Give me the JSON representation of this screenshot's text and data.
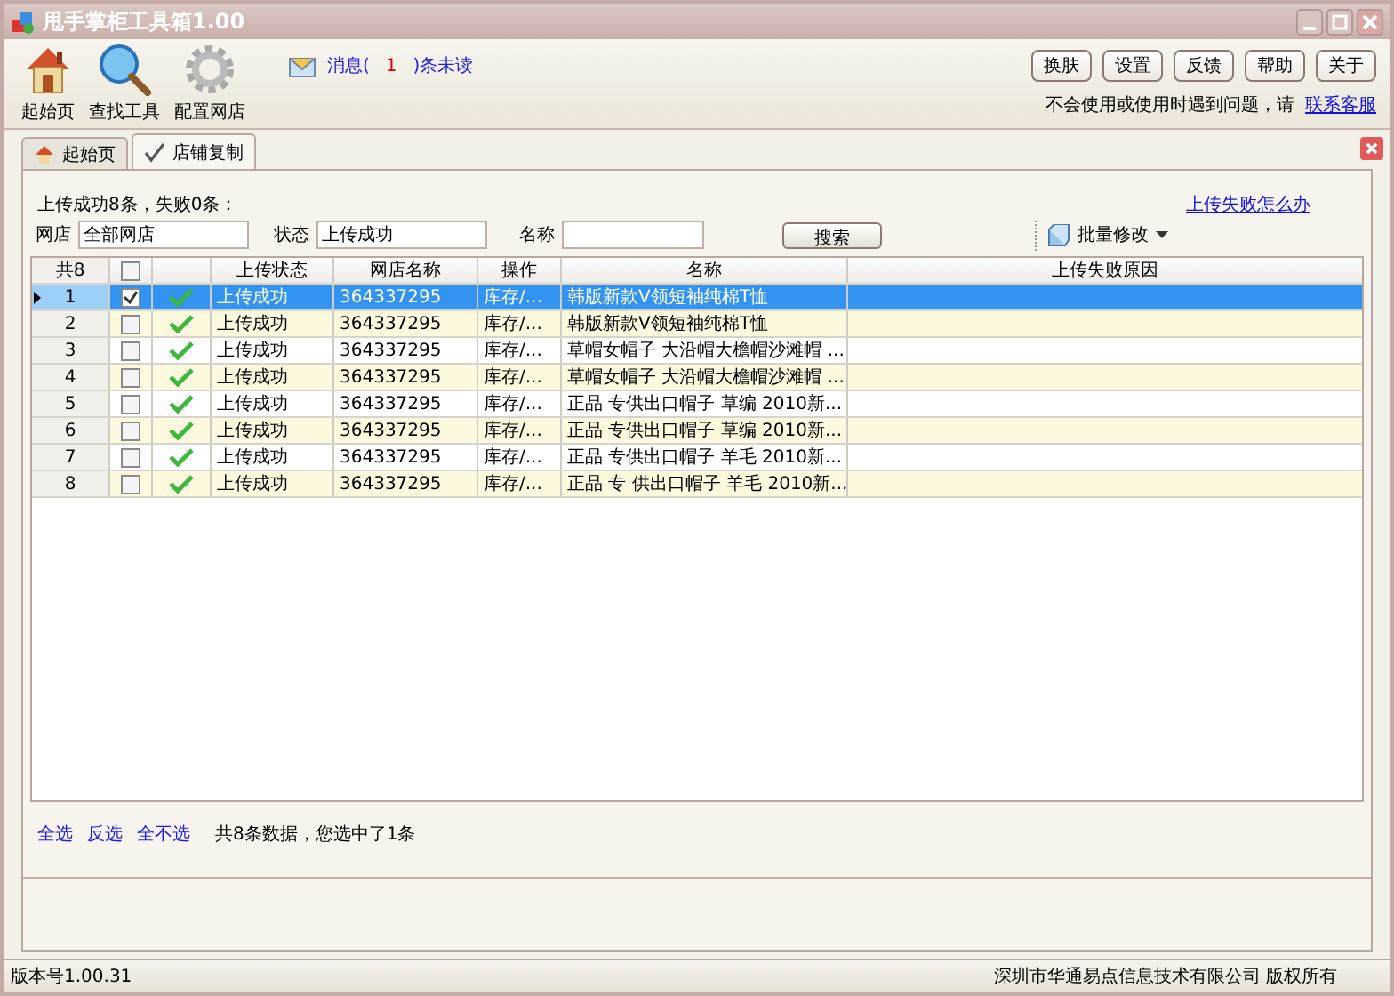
{
  "window": {
    "title": "甩手掌柜工具箱1.00"
  },
  "toolbar": {
    "tools": [
      {
        "label": "起始页"
      },
      {
        "label": "查找工具"
      },
      {
        "label": "配置网店"
      }
    ],
    "message": {
      "prefix": "消息(",
      "count": "1",
      "suffix": ")条未读"
    },
    "buttons": [
      "换肤",
      "设置",
      "反馈",
      "帮助",
      "关于"
    ],
    "help_text": "不会使用或使用时遇到问题，请",
    "help_link": "联系客服"
  },
  "tabs": [
    {
      "label": "起始页",
      "selected": false
    },
    {
      "label": "店铺复制",
      "selected": true
    }
  ],
  "panel": {
    "summary": "上传成功8条，失败0条：",
    "help_link": "上传失败怎么办",
    "filters": [
      {
        "label": "网店",
        "value": "全部网店"
      },
      {
        "label": "状态",
        "value": "上传成功"
      },
      {
        "label": "名称"
      }
    ],
    "search_button": "搜索",
    "batch_button": "批量修改",
    "table": {
      "count_header": "共8",
      "header_checked": false,
      "columns": [
        "上传状态",
        "网店名称",
        "操作",
        "名称",
        "上传失败原因"
      ],
      "rows": [
        {
          "index": "1",
          "selected": true,
          "checked": true,
          "status": "上传成功",
          "shop": "364337295",
          "op": "库存/...",
          "name": "韩版新款V领短袖纯棉T恤"
        },
        {
          "index": "2",
          "selected": false,
          "checked": false,
          "status": "上传成功",
          "shop": "364337295",
          "op": "库存/...",
          "name": "韩版新款V领短袖纯棉T恤"
        },
        {
          "index": "3",
          "selected": false,
          "checked": false,
          "status": "上传成功",
          "shop": "364337295",
          "op": "库存/...",
          "name": "草帽女帽子 大沿帽大檐帽沙滩帽 ..."
        },
        {
          "index": "4",
          "selected": false,
          "checked": false,
          "status": "上传成功",
          "shop": "364337295",
          "op": "库存/...",
          "name": "草帽女帽子 大沿帽大檐帽沙滩帽 ..."
        },
        {
          "index": "5",
          "selected": false,
          "checked": false,
          "status": "上传成功",
          "shop": "364337295",
          "op": "库存/...",
          "name": "正品 专供出口帽子 草编 2010新..."
        },
        {
          "index": "6",
          "selected": false,
          "checked": false,
          "status": "上传成功",
          "shop": "364337295",
          "op": "库存/...",
          "name": "正品 专供出口帽子 草编 2010新..."
        },
        {
          "index": "7",
          "selected": false,
          "checked": false,
          "status": "上传成功",
          "shop": "364337295",
          "op": "库存/...",
          "name": "正品 专供出口帽子 羊毛 2010新..."
        },
        {
          "index": "8",
          "selected": false,
          "checked": false,
          "status": "上传成功",
          "shop": "364337295",
          "op": "库存/...",
          "name": "正品 专 供出口帽子 羊毛 2010新..."
        }
      ]
    },
    "select_links": [
      "全选",
      "反选",
      "全不选"
    ],
    "selection_info": "共8条数据，您选中了1条"
  },
  "status_bar": {
    "version": "版本号1.00.31",
    "copyright": "深圳市华通易点信息技术有限公司 版权所有"
  }
}
